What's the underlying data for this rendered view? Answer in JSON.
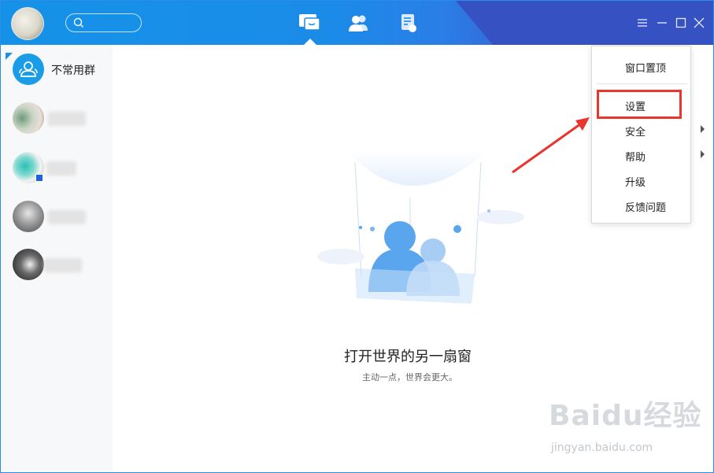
{
  "header": {
    "search": {
      "placeholder": "",
      "value": ""
    },
    "tabs": [
      {
        "icon": "message-icon",
        "active": true
      },
      {
        "icon": "contacts-icon",
        "active": false
      },
      {
        "icon": "files-icon",
        "active": false
      }
    ],
    "window_controls": [
      "menu-icon",
      "minimize-icon",
      "maximize-icon",
      "close-icon"
    ]
  },
  "sidebar": {
    "items": [
      {
        "label": "不常用群",
        "icon": "group-icon"
      },
      {
        "label": "",
        "blurred": true
      },
      {
        "label": "",
        "blurred": true
      },
      {
        "label": "",
        "blurred": true
      },
      {
        "label": "",
        "blurred": true
      }
    ]
  },
  "main": {
    "title": "打开世界的另一扇窗",
    "subtitle": "主动一点，世界会更大。"
  },
  "dropdown": {
    "items": [
      {
        "label": "窗口置顶",
        "submenu": false
      },
      {
        "label": "设置",
        "submenu": false,
        "highlighted": true
      },
      {
        "label": "安全",
        "submenu": true
      },
      {
        "label": "帮助",
        "submenu": true
      },
      {
        "label": "升级",
        "submenu": false
      },
      {
        "label": "反馈问题",
        "submenu": false
      }
    ]
  },
  "watermark": {
    "main": "Baidu经验",
    "sub": "jingyan.baidu.com"
  },
  "colors": {
    "accent": "#1592e8",
    "header_dark": "#3652c2",
    "highlight_border": "#e8362f",
    "illustration_blue": "#5aa6ee"
  }
}
